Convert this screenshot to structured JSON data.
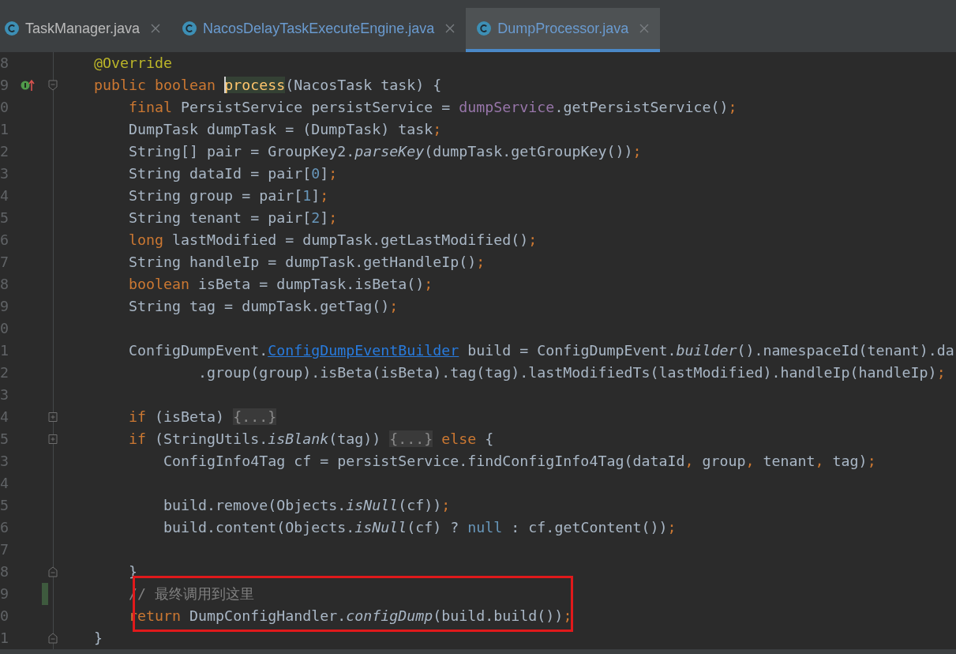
{
  "tabs": [
    {
      "label": "TaskManager.java",
      "selected": false,
      "color": "#bbbbbb"
    },
    {
      "label": "NacosDelayTaskExecuteEngine.java",
      "selected": false,
      "color": "#6a9bd0"
    },
    {
      "label": "DumpProcessor.java",
      "selected": true,
      "color": "#6a9bd0"
    }
  ],
  "editor": {
    "lines": [
      {
        "number": "8",
        "changed": false,
        "boxed": false,
        "segments": [
          {
            "kind": "annotation",
            "text": "    @Override"
          }
        ]
      },
      {
        "number": "9",
        "changed": false,
        "boxed": false,
        "gutter_icon": {
          "kind": "implements"
        },
        "fold_marker": {
          "kind": "start"
        },
        "segments": [
          {
            "kind": "keyword",
            "text": "    public boolean "
          },
          {
            "kind": "declaration",
            "text": "process",
            "caret": true
          },
          {
            "kind": "plain",
            "text": "(NacosTask task) {"
          }
        ]
      },
      {
        "number": "0",
        "changed": false,
        "boxed": false,
        "segments": [
          {
            "kind": "keyword",
            "text": "        final"
          },
          {
            "kind": "plain",
            "text": " PersistService persistService = "
          },
          {
            "kind": "field",
            "text": "dumpService"
          },
          {
            "kind": "plain",
            "text": ".getPersistService()"
          },
          {
            "kind": "punct",
            "text": ";"
          }
        ]
      },
      {
        "number": "1",
        "changed": false,
        "boxed": false,
        "segments": [
          {
            "kind": "plain",
            "text": "        DumpTask dumpTask = (DumpTask) task"
          },
          {
            "kind": "punct",
            "text": ";"
          }
        ]
      },
      {
        "number": "2",
        "changed": false,
        "boxed": false,
        "segments": [
          {
            "kind": "plain",
            "text": "        String[] pair = GroupKey2."
          },
          {
            "kind": "static",
            "text": "parseKey"
          },
          {
            "kind": "plain",
            "text": "(dumpTask.getGroupKey())"
          },
          {
            "kind": "punct",
            "text": ";"
          }
        ]
      },
      {
        "number": "3",
        "changed": false,
        "boxed": false,
        "segments": [
          {
            "kind": "plain",
            "text": "        String dataId = pair["
          },
          {
            "kind": "number",
            "text": "0"
          },
          {
            "kind": "plain",
            "text": "]"
          },
          {
            "kind": "punct",
            "text": ";"
          }
        ]
      },
      {
        "number": "4",
        "changed": false,
        "boxed": false,
        "segments": [
          {
            "kind": "plain",
            "text": "        String group = pair["
          },
          {
            "kind": "number",
            "text": "1"
          },
          {
            "kind": "plain",
            "text": "]"
          },
          {
            "kind": "punct",
            "text": ";"
          }
        ]
      },
      {
        "number": "5",
        "changed": false,
        "boxed": false,
        "segments": [
          {
            "kind": "plain",
            "text": "        String tenant = pair["
          },
          {
            "kind": "number",
            "text": "2"
          },
          {
            "kind": "plain",
            "text": "]"
          },
          {
            "kind": "punct",
            "text": ";"
          }
        ]
      },
      {
        "number": "6",
        "changed": false,
        "boxed": false,
        "segments": [
          {
            "kind": "keyword",
            "text": "        long"
          },
          {
            "kind": "plain",
            "text": " lastModified = dumpTask.getLastModified()"
          },
          {
            "kind": "punct",
            "text": ";"
          }
        ]
      },
      {
        "number": "7",
        "changed": false,
        "boxed": false,
        "segments": [
          {
            "kind": "plain",
            "text": "        String handleIp = dumpTask.getHandleIp()"
          },
          {
            "kind": "punct",
            "text": ";"
          }
        ]
      },
      {
        "number": "8",
        "changed": false,
        "boxed": false,
        "segments": [
          {
            "kind": "keyword",
            "text": "        boolean"
          },
          {
            "kind": "plain",
            "text": " isBeta = dumpTask.isBeta()"
          },
          {
            "kind": "punct",
            "text": ";"
          }
        ]
      },
      {
        "number": "9",
        "changed": false,
        "boxed": false,
        "segments": [
          {
            "kind": "plain",
            "text": "        String tag = dumpTask.getTag()"
          },
          {
            "kind": "punct",
            "text": ";"
          }
        ]
      },
      {
        "number": "0",
        "changed": false,
        "boxed": false
      },
      {
        "number": "1",
        "changed": false,
        "boxed": false,
        "segments": [
          {
            "kind": "plain",
            "text": "        ConfigDumpEvent."
          },
          {
            "kind": "link",
            "text": "ConfigDumpEventBuilder"
          },
          {
            "kind": "plain",
            "text": " build = ConfigDumpEvent."
          },
          {
            "kind": "static",
            "text": "builder"
          },
          {
            "kind": "plain",
            "text": "().namespaceId(tenant).da"
          }
        ]
      },
      {
        "number": "2",
        "changed": false,
        "boxed": false,
        "segments": [
          {
            "kind": "plain",
            "text": "                .group(group).isBeta(isBeta).tag(tag).lastModifiedTs(lastModified).handleIp(handleIp)"
          },
          {
            "kind": "punct",
            "text": ";"
          }
        ]
      },
      {
        "number": "3",
        "changed": false,
        "boxed": false
      },
      {
        "number": "4",
        "changed": false,
        "boxed": false,
        "fold_marker": {
          "kind": "collapsed"
        },
        "segments": [
          {
            "kind": "keyword",
            "text": "        if"
          },
          {
            "kind": "plain",
            "text": " (isBeta) "
          },
          {
            "kind": "folded",
            "text": "{...}"
          }
        ]
      },
      {
        "number": "5",
        "changed": false,
        "boxed": false,
        "fold_marker": {
          "kind": "collapsed"
        },
        "segments": [
          {
            "kind": "keyword",
            "text": "        if"
          },
          {
            "kind": "plain",
            "text": " (StringUtils."
          },
          {
            "kind": "static",
            "text": "isBlank"
          },
          {
            "kind": "plain",
            "text": "(tag)) "
          },
          {
            "kind": "folded",
            "text": "{...}"
          },
          {
            "kind": "keyword",
            "text": " else"
          },
          {
            "kind": "plain",
            "text": " {"
          }
        ]
      },
      {
        "number": "3",
        "changed": false,
        "boxed": false,
        "segments": [
          {
            "kind": "plain",
            "text": "            ConfigInfo4Tag cf = persistService.findConfigInfo4Tag(dataId"
          },
          {
            "kind": "punct",
            "text": ","
          },
          {
            "kind": "plain",
            "text": " group"
          },
          {
            "kind": "punct",
            "text": ","
          },
          {
            "kind": "plain",
            "text": " tenant"
          },
          {
            "kind": "punct",
            "text": ","
          },
          {
            "kind": "plain",
            "text": " tag)"
          },
          {
            "kind": "punct",
            "text": ";"
          }
        ]
      },
      {
        "number": "4",
        "changed": false,
        "boxed": false
      },
      {
        "number": "5",
        "changed": false,
        "boxed": false,
        "segments": [
          {
            "kind": "plain",
            "text": "            build.remove(Objects."
          },
          {
            "kind": "static",
            "text": "isNull"
          },
          {
            "kind": "plain",
            "text": "(cf))"
          },
          {
            "kind": "punct",
            "text": ";"
          }
        ]
      },
      {
        "number": "6",
        "changed": false,
        "boxed": false,
        "segments": [
          {
            "kind": "plain",
            "text": "            build.content(Objects."
          },
          {
            "kind": "static",
            "text": "isNull"
          },
          {
            "kind": "plain",
            "text": "(cf) ? "
          },
          {
            "kind": "literal",
            "text": "null"
          },
          {
            "kind": "plain",
            "text": " : cf.getContent())"
          },
          {
            "kind": "punct",
            "text": ";"
          }
        ]
      },
      {
        "number": "7",
        "changed": false,
        "boxed": false
      },
      {
        "number": "8",
        "changed": false,
        "boxed": false,
        "fold_marker": {
          "kind": "end"
        },
        "segments": [
          {
            "kind": "plain",
            "text": "        }"
          }
        ]
      },
      {
        "number": "9",
        "changed": true,
        "boxed": true,
        "segments": [
          {
            "kind": "comment",
            "text": "        // 最终调用到这里"
          }
        ]
      },
      {
        "number": "0",
        "changed": false,
        "boxed": true,
        "segments": [
          {
            "kind": "keyword",
            "text": "        return"
          },
          {
            "kind": "plain",
            "text": " DumpConfigHandler."
          },
          {
            "kind": "static",
            "text": "configDump"
          },
          {
            "kind": "plain",
            "text": "(build.build())"
          },
          {
            "kind": "punct",
            "text": ";"
          }
        ]
      },
      {
        "number": "1",
        "changed": false,
        "boxed": false,
        "fold_marker": {
          "kind": "end"
        },
        "segments": [
          {
            "kind": "plain",
            "text": "    }"
          }
        ]
      }
    ]
  }
}
